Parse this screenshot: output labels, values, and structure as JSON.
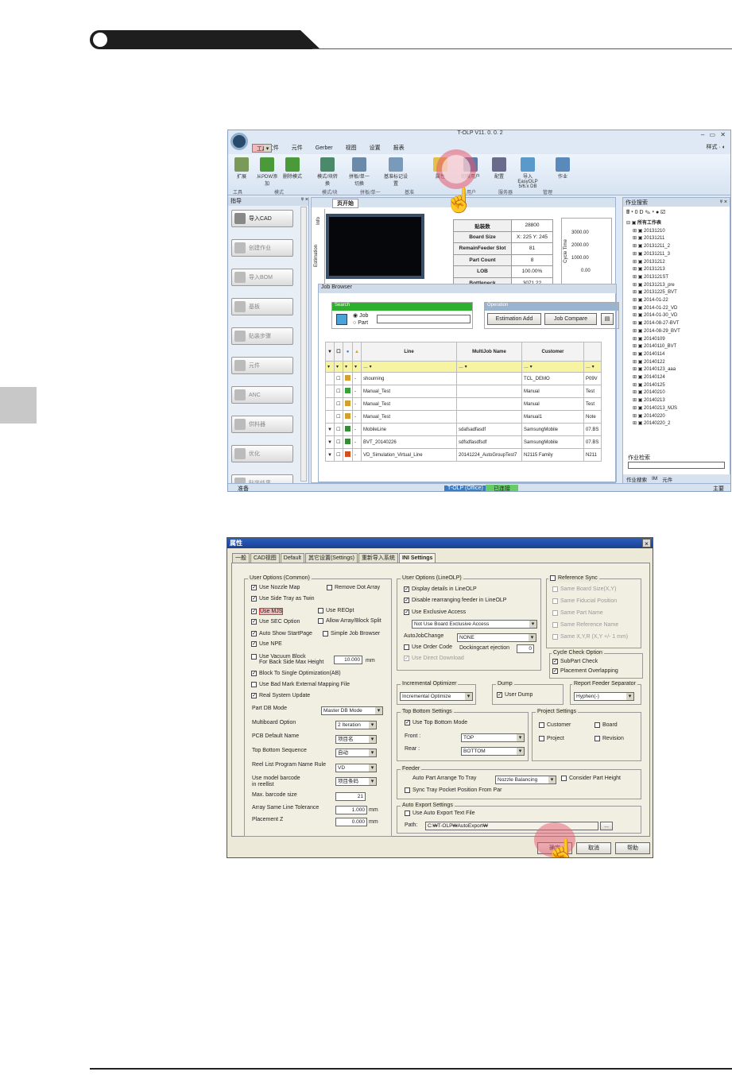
{
  "page": {
    "footer_line": true
  },
  "window1": {
    "title": "T-OLP V11. 0. 0. 2",
    "controls": "– ▭ ✕",
    "menu": [
      "CAD文件",
      "元件",
      "Gerber",
      "视图",
      "设置",
      "报表",
      "工具"
    ],
    "menu_selected": "工具",
    "style_label": "样式 · ◐",
    "ribbon": [
      {
        "label": "扩展",
        "color": "#7a9a5a"
      },
      {
        "label": "从PDW添加",
        "color": "#4a9a3a"
      },
      {
        "label": "删除模式",
        "color": "#4a9a3a"
      },
      {
        "label": "模式/块转换",
        "color": "#4a8a6a"
      },
      {
        "label": "拼板/单一切换",
        "color": "#6a8aaa"
      },
      {
        "label": "基准标记设置",
        "color": "#7a9aba"
      },
      {
        "label": "属性",
        "color": "#e2c04a"
      },
      {
        "label": "切换用户",
        "color": "#5a7aaa"
      },
      {
        "label": "配置",
        "color": "#6a6a8a"
      },
      {
        "label": "导入 EasyOLP 5/6.x DB",
        "color": "#5a9aca"
      },
      {
        "label": "作业",
        "color": "#5a8aba"
      }
    ],
    "groups": [
      "工具",
      "模式",
      "模式/块",
      "拼板/单一",
      "基准",
      "用户",
      "服务器",
      "管理"
    ],
    "left_panel": {
      "title": "指导",
      "pin": "ᵠ ×",
      "buttons": [
        "导入CAD",
        "创建作业",
        "导入BOM",
        "基板",
        "贴装步骤",
        "元件",
        "ANC",
        "供料器",
        "优化",
        "贴装结果"
      ]
    },
    "doc_tab": "页开始",
    "vtabs": [
      "Info",
      "Estimation"
    ],
    "stats": [
      [
        "贴装数",
        "28800"
      ],
      [
        "Board Size",
        "X: 225  Y: 245"
      ],
      [
        "RemainFeeder Slot",
        "81"
      ],
      [
        "Part Count",
        "8"
      ],
      [
        "LOB",
        "100.00%"
      ],
      [
        "Bottleneck",
        "3071.22"
      ]
    ],
    "cycle_axis": {
      "label": "Cycle Time",
      "ticks": [
        "3000.00",
        "2000.00",
        "1000.00",
        "0.00"
      ]
    },
    "job_browser": "Job Browser",
    "search_title": "Search",
    "radio": [
      "Job",
      "Part"
    ],
    "operation_title": "Operation",
    "ops": [
      "Estimation Add",
      "Job Compare"
    ],
    "grid_headers": [
      "Line",
      "MultiJob Name",
      "Customer"
    ],
    "grid_rows": [
      {
        "exp": "",
        "line": "shourning",
        "multi": "",
        "cust": "TCL_DEMO",
        "tail": "P09V",
        "ic": "#d0a030"
      },
      {
        "exp": "",
        "line": "Manual_Test",
        "multi": "",
        "cust": "Manual",
        "tail": "Test",
        "ic": "#3aa03a"
      },
      {
        "exp": "",
        "line": "Manual_Test",
        "multi": "",
        "cust": "Manual",
        "tail": "Test",
        "ic": "#d0a030"
      },
      {
        "exp": "",
        "line": "Manual_Test",
        "multi": "",
        "cust": "Manual1",
        "tail": "Note",
        "ic": "#d0a030"
      },
      {
        "exp": "▼",
        "line": "MobileLine",
        "multi": "sdafsadfasdf",
        "cust": "SamsungMobile",
        "tail": "07.BS",
        "ic": "#3a8a3a"
      },
      {
        "exp": "▼",
        "line": "BVT_20140226",
        "multi": "sdfsdfasdfsdf",
        "cust": "SamsungMobile",
        "tail": "07.BS",
        "ic": "#3a8a3a"
      },
      {
        "exp": "▼",
        "line": "VD_Simulation_Virtual_Line",
        "multi": "20141224_AutoGroupTest7",
        "cust": "N2115 Family",
        "tail": "N211",
        "ic": "#d05020"
      }
    ],
    "right_panel": {
      "title": "作业搜索",
      "pin": "ᵠ ×",
      "toolbar": "🖩 ▾ 0 D ✎ ▾ ● ☑",
      "root": "所有工作表",
      "items": [
        "20131210",
        "20131211",
        "20131211_2",
        "20131211_3",
        "20131212",
        "20131213",
        "2013121ST",
        "20131213_pre",
        "20131225_BVT",
        "2014-01-22",
        "2014-01-22_VD",
        "2014-01-30_VD",
        "2014-08-27-BVT",
        "2014-08-29_BVT",
        "20140109",
        "20140110_BVT",
        "20140114",
        "20140122",
        "20140123_aaa",
        "20140124",
        "20140125",
        "20140210",
        "20140213",
        "20140213_MJS",
        "20140220",
        "20140220_2"
      ],
      "search_label": "作业检索",
      "bottom_tabs": [
        "作业搜索",
        "IM",
        "元件"
      ]
    },
    "status": {
      "left": "准备",
      "center": "T-OLP (Office)",
      "state": "已连接",
      "right": "主要"
    }
  },
  "dialog": {
    "title": "属性",
    "close": "×",
    "tabs": [
      "一般",
      "CAD视图",
      "Default",
      "其它设置(Settings)",
      "重新导入系统",
      "INI Settings"
    ],
    "common_title": "User Options (Common)",
    "common": {
      "nozzle": "Use Nozzle Map",
      "remove_dot": "Remove Dot Array",
      "side_tray": "Use Side Tray as Twin",
      "mjs": "Use MJS",
      "reopt": "Use REOpt",
      "sec": "Use SEC Option",
      "allow_array": "Allow Array/Block Split",
      "auto_show": "Auto Show StartPage",
      "simple_job": "Simple Job Browser",
      "npe": "Use NPE",
      "vacuum1": "Use Vacuum Block",
      "vacuum2": "For Back Side Max Height",
      "vacuum_val": "10.000",
      "mm": "mm",
      "block_single": "Block To Single Optimization(AB)",
      "bad_mark": "Use Bad Mark External Mapping File",
      "real_sys": "Real System Update",
      "part_db": "Part DB Mode",
      "part_db_val": "Master DB Mode",
      "multiboard": "Multiboard Option",
      "multiboard_val": "2 Iteration",
      "pcb_name": "PCB Default Name",
      "pcb_name_val": "项目名",
      "tb_seq": "Top Bottom Sequence",
      "tb_seq_val": "自动",
      "reel": "Reel List Program Name Rule",
      "reel_val": "VD",
      "model_bc1": "Use model barcode",
      "model_bc2": "in reellist",
      "model_bc_val": "项目条码",
      "max_bc": "Max. barcode size",
      "max_bc_val": "21",
      "array_tol": "Array Same Line Tolerance",
      "array_tol_val": "1.000",
      "place_z": "Placement Z",
      "place_z_val": "0.000"
    },
    "lineolp_title": "User Options (LineOLP)",
    "lineolp": {
      "display": "Display details in LineOLP",
      "disable": "Disable rearranging feeder in LineOLP",
      "exclusive": "Use Exclusive Access",
      "excl_val": "Not Use Board Exclusive Access",
      "autojob": "AutoJobChange",
      "autojob_val": "NONE",
      "order": "Use Order Code",
      "docking": "Dockingcart ejection",
      "docking_val": "0",
      "direct": "Use Direct Download"
    },
    "ref_title": "Reference Sync",
    "ref": [
      "Same Board Size(X,Y)",
      "Same Fiducial Position",
      "Same Part Name",
      "Same Reference Name",
      "Same X,Y,R (X,Y +/- 1 mm)"
    ],
    "cycle_title": "Cycle Check Option",
    "cycle": [
      "SubPart Check",
      "Placement Overlapping"
    ],
    "incr_title": "Incremental Optimizer",
    "incr_val": "Incremental Optimize",
    "dump_title": "Dump",
    "dump": "User Dump",
    "report_title": "Report Feeder Separator",
    "report_val": "Hyphen(-)",
    "topbot_title": "Top Bottom Settings",
    "topbot": "Use Top Bottom Mode",
    "front": "Front :",
    "front_val": "TOP",
    "rear": "Rear :",
    "rear_val": "BOTTOM",
    "proj_title": "Project Settings",
    "proj": [
      "Customer",
      "Board",
      "Project",
      "Revision"
    ],
    "feeder_title": "Feeder",
    "feeder_arrange": "Auto Part Arrange To Tray",
    "feeder_val": "Nozzle Balancing",
    "consider": "Consider Part Height",
    "sync_tray": "Sync Tray Pocket Position From Par",
    "export_title": "Auto Export Settings",
    "export": "Use Auto Export Text File",
    "path_label": "Path:",
    "path_val": "C:₩T-OLP₩AutoExport₩",
    "browse": "...",
    "buttons": [
      "确定",
      "取消",
      "帮助"
    ]
  }
}
